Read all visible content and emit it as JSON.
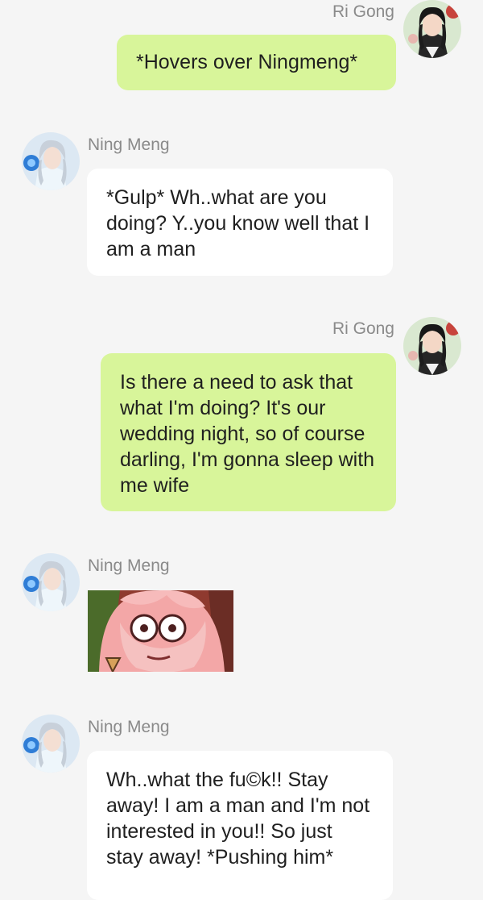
{
  "messages": [
    {
      "side": "right",
      "sender": "Ri Gong",
      "avatar_icon": "ri-gong-avatar",
      "text": "*Hovers over Ningmeng*"
    },
    {
      "side": "left",
      "sender": "Ning Meng",
      "avatar_icon": "ning-meng-avatar",
      "text": "*Gulp* Wh..what are you doing? Y..you know well that I am a man"
    },
    {
      "side": "right",
      "sender": "Ri Gong",
      "avatar_icon": "ri-gong-avatar",
      "text": "Is there a need to ask that what I'm doing? It's our wedding night, so of course darling, I'm gonna sleep with me wife"
    },
    {
      "side": "left",
      "sender": "Ning Meng",
      "avatar_icon": "ning-meng-avatar",
      "sticker": "shocked-pink-haired-anime-face"
    },
    {
      "side": "left",
      "sender": "Ning Meng",
      "avatar_icon": "ning-meng-avatar",
      "text": "Wh..what the fu©k!! Stay away! I am a man and I'm not interested in you!! So just stay away! *Pushing him*"
    }
  ],
  "colors": {
    "background": "#f5f5f5",
    "right_bubble": "#d8f59a",
    "left_bubble": "#ffffff",
    "name_text": "#8a8a8a",
    "message_text": "#1f1f1f"
  }
}
